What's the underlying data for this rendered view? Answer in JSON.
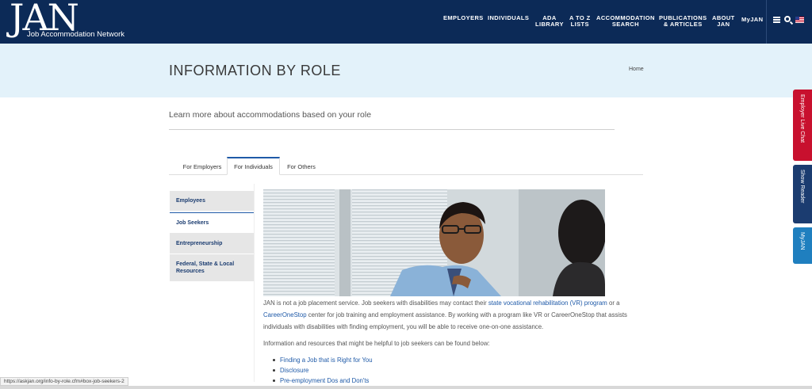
{
  "header": {
    "logo_main": "JAN",
    "logo_sub": "Job Accommodation Network",
    "nav": [
      {
        "label": "EMPLOYERS"
      },
      {
        "label": "INDIVIDUALS"
      },
      {
        "line1": "ADA",
        "line2": "LIBRARY"
      },
      {
        "line1": "A TO Z",
        "line2": "LISTS"
      },
      {
        "line1": "ACCOMMODATION",
        "line2": "SEARCH"
      },
      {
        "line1": "PUBLICATIONS",
        "line2": "& ARTICLES"
      },
      {
        "line1": "ABOUT",
        "line2": "JAN"
      },
      {
        "label": "MyJAN"
      }
    ],
    "icons": [
      "menu-icon",
      "search-icon",
      "us-flag-icon"
    ]
  },
  "page": {
    "title": "INFORMATION BY ROLE",
    "breadcrumb": "Home",
    "subtitle": "Learn more about accommodations based on your role"
  },
  "tabs": [
    {
      "label": "For Employers",
      "active": false
    },
    {
      "label": "For Individuals",
      "active": true
    },
    {
      "label": "For Others",
      "active": false
    }
  ],
  "side_menu": [
    {
      "label": "Employees",
      "active": false
    },
    {
      "label": "Job Seekers",
      "active": true
    },
    {
      "label": "Entrepreneurship",
      "active": false
    },
    {
      "label": "Federal, State & Local Resources",
      "active": false
    }
  ],
  "content": {
    "p1_a": "JAN is not a job placement service. Job seekers with disabilities may contact their ",
    "p1_link1": "state vocational rehabilitation (VR) program",
    "p1_b": " or a ",
    "p1_link2": "CareerOneStop",
    "p1_c": " center for job training and employment assistance. By working with a program like VR or CareerOneStop that assists individuals with disabilities with finding employment, you will be able to receive one-on-one assistance.",
    "p2": "Information and resources that might be helpful to job seekers can be found below:",
    "links": [
      "Finding a Job that is Right for You",
      "Disclosure",
      "Pre-employment Dos and Don'ts"
    ]
  },
  "side_tabs": [
    {
      "label": "Employer Live Chat",
      "color": "#c8102e"
    },
    {
      "label": "Show Reader",
      "color": "#1b3c70"
    },
    {
      "label": "MyJAN",
      "color": "#1f7fbf"
    }
  ],
  "status_url": "https://askjan.org/info-by-role.cfm#box-job-seekers-2",
  "colors": {
    "header": "#0c2a57",
    "band": "#e3f2fa",
    "link": "#1f5aa8"
  }
}
